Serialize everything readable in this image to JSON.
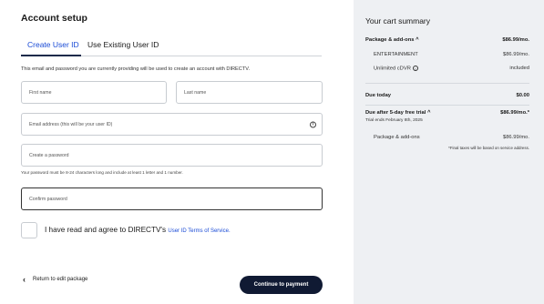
{
  "page": {
    "title": "Account setup"
  },
  "tabs": [
    {
      "label": "Create User ID",
      "active": true
    },
    {
      "label": "Use Existing User ID",
      "active": false
    }
  ],
  "info_text": "This email and password you are currently providing will be used to create an account with DIRECTV.",
  "form": {
    "first_name": {
      "placeholder": "First name",
      "value": ""
    },
    "last_name": {
      "placeholder": "Last name",
      "value": ""
    },
    "email": {
      "placeholder": "Email address (this will be your user ID)",
      "value": ""
    },
    "password": {
      "placeholder": "Create a password",
      "value": ""
    },
    "password_hint": "Your password must be 8-24 characters long and include at least 1 letter and 1 number.",
    "confirm_password": {
      "placeholder": "Confirm password",
      "value": ""
    },
    "agree_text": "I have read and agree to DIRECTV's",
    "agree_link": "User ID Terms of Service."
  },
  "footer": {
    "back_label": "Return to edit package",
    "continue_label": "Continue to payment"
  },
  "cart": {
    "title": "Your cart summary",
    "package_header": {
      "label": "Package & add-ons",
      "value": "$86.99/mo."
    },
    "items": [
      {
        "label": "ENTERTAINMENT",
        "value": "$86.99/mo."
      },
      {
        "label": "Unlimited cDVR",
        "value": "included"
      }
    ],
    "due_today": {
      "label": "Due today",
      "value": "$0.00"
    },
    "due_after": {
      "label": "Due after 5-day free trial",
      "value": "$86.99/mo.*"
    },
    "trial_ends": "Trial ends February 8th, 2025",
    "after_package": {
      "label": "Package & add-ons",
      "value": "$86.99/mo."
    },
    "tax_note": "*Final taxes will be based on service address."
  },
  "colors": {
    "accent_blue": "#1a4bd6",
    "button_dark": "#101a33",
    "summary_bg": "#eef0f3"
  }
}
